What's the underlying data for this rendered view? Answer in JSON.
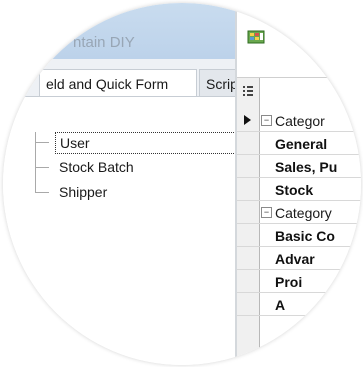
{
  "window": {
    "title_fragment": "ntain DIY"
  },
  "tabs": [
    {
      "label": "eld and Quick Form"
    },
    {
      "label": "Scrip"
    }
  ],
  "tree": {
    "items": [
      {
        "label": "User",
        "selected": true
      },
      {
        "label": "Stock Batch",
        "selected": false
      },
      {
        "label": "Shipper",
        "selected": false
      }
    ]
  },
  "property_grid": {
    "rows": [
      {
        "kind": "category",
        "label": "Categor"
      },
      {
        "kind": "item",
        "label": "General"
      },
      {
        "kind": "item",
        "label": "Sales, Pu"
      },
      {
        "kind": "item",
        "label": "Stock"
      },
      {
        "kind": "category",
        "label": "Category"
      },
      {
        "kind": "item",
        "label": "Basic Co"
      },
      {
        "kind": "item",
        "label": "Advar"
      },
      {
        "kind": "item",
        "label": "Proi"
      },
      {
        "kind": "item",
        "label": "A"
      }
    ]
  },
  "colors": {
    "titlebar": "#bcd2ea",
    "grid_header": "#f0f0f0",
    "tree_line": "#a9a9a9"
  },
  "icons": [
    "database-icon",
    "grid-sort-icon",
    "current-row-arrow-icon",
    "collapse-icon"
  ]
}
